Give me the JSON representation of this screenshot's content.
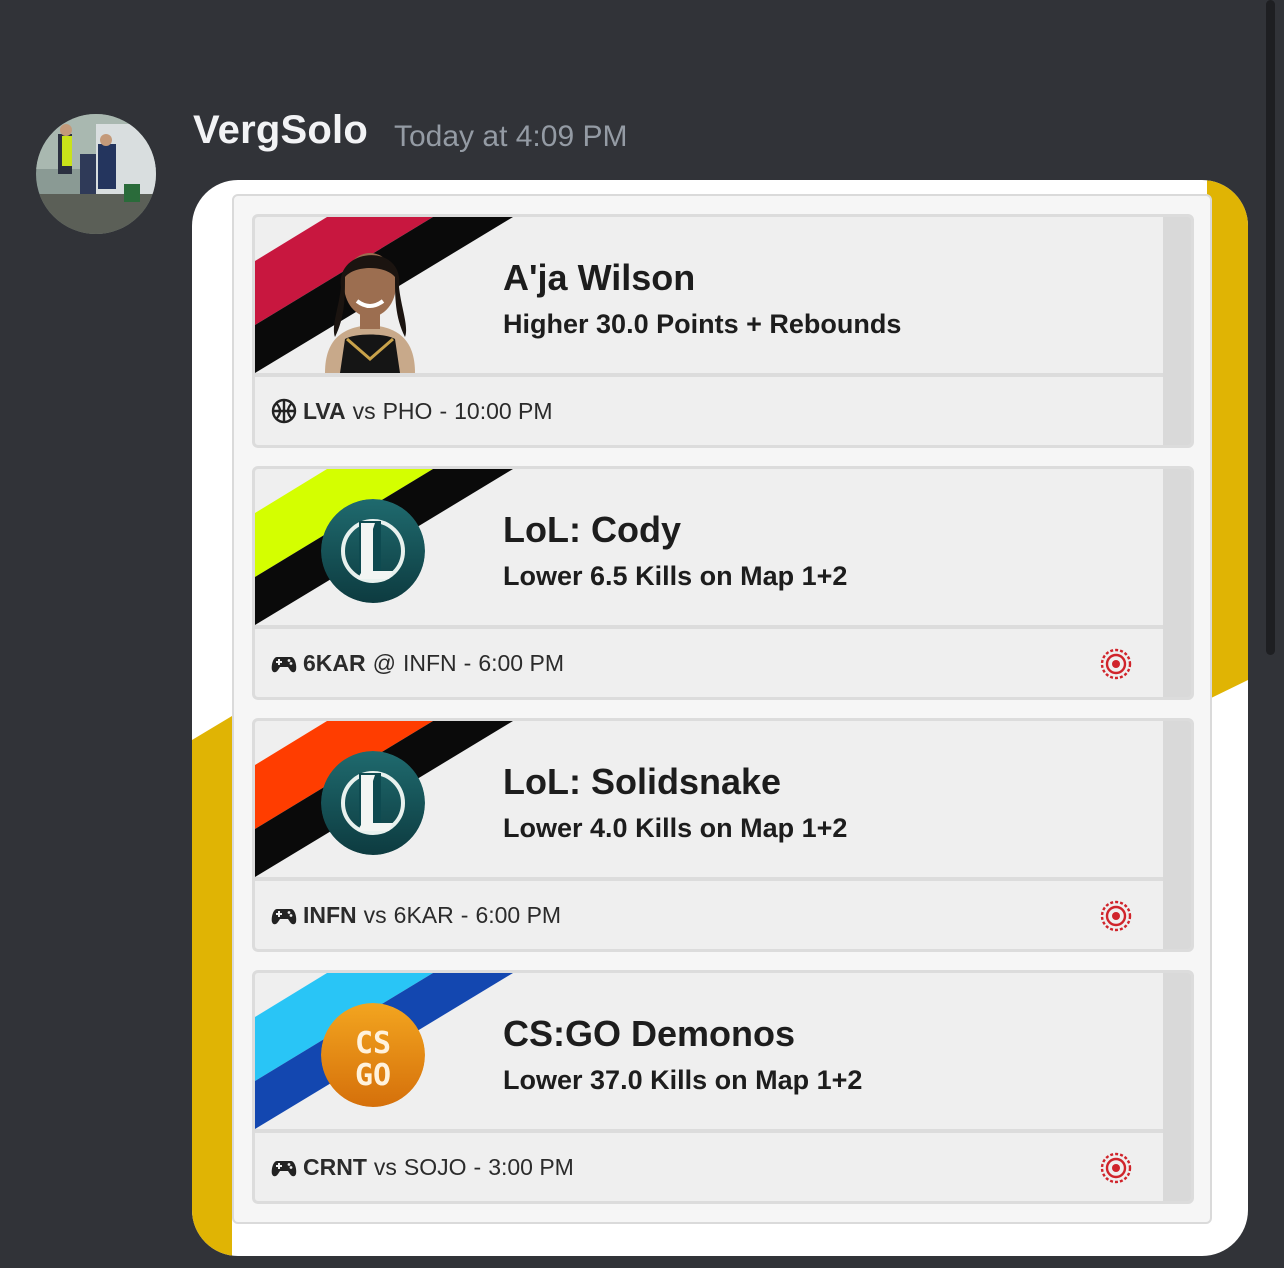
{
  "message": {
    "username": "VergSolo",
    "timestamp": "Today at 4:09 PM"
  },
  "colors": {
    "gold_accent": "#e0b404",
    "discord_bg": "#313338"
  },
  "picks": [
    {
      "title": "A'ja Wilson",
      "line_dir": "Higher",
      "line_rest": "30.0 Points + Rebounds",
      "sport_icon": "basketball-icon",
      "team": "LVA",
      "sep": "vs",
      "opponent": "PHO",
      "time": "10:00 PM",
      "stripe_color": "#c8173f",
      "has_target": false
    },
    {
      "title": "LoL: Cody",
      "line_dir": "Lower",
      "line_rest": "6.5 Kills on Map 1+2",
      "sport_icon": "gamepad-icon",
      "team": "6KAR",
      "sep": "@",
      "opponent": "INFN",
      "time": "6:00 PM",
      "stripe_color": "#d4ff00",
      "has_target": true
    },
    {
      "title": "LoL: Solidsnake",
      "line_dir": "Lower",
      "line_rest": "4.0 Kills on Map 1+2",
      "sport_icon": "gamepad-icon",
      "team": "INFN",
      "sep": "vs",
      "opponent": "6KAR",
      "time": "6:00 PM",
      "stripe_color": "#ff3d00",
      "has_target": true
    },
    {
      "title": "CS:GO Demonos",
      "line_dir": "Lower",
      "line_rest": "37.0 Kills on Map 1+2",
      "sport_icon": "gamepad-icon",
      "team": "CRNT",
      "sep": "vs",
      "opponent": "SOJO",
      "time": "3:00 PM",
      "stripe_color": "#29c5f6",
      "has_target": true
    }
  ]
}
